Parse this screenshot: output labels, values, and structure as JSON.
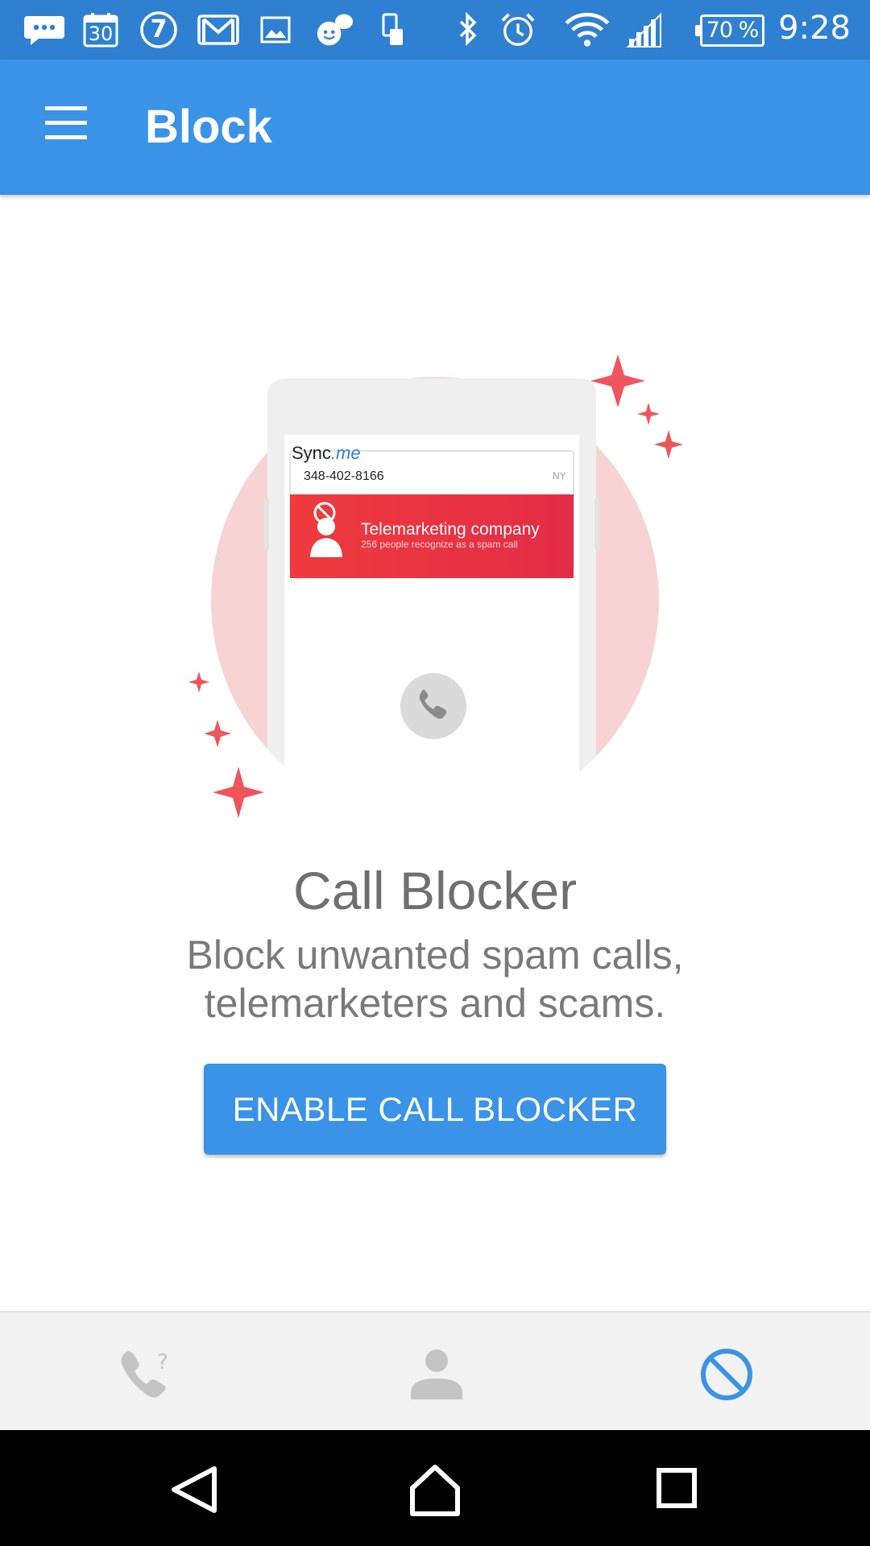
{
  "status_bar": {
    "calendar_day": "30",
    "badge_number": "7",
    "battery": "70 %",
    "time": "9:28"
  },
  "app_bar": {
    "title": "Block"
  },
  "illustration": {
    "brand": "Sync.me",
    "phone_number": "348-402-8166",
    "region": "NY",
    "caller_label": "Telemarketing company",
    "caller_sub": "256 people recognize as a spam call"
  },
  "content": {
    "title": "Call Blocker",
    "description": "Block unwanted spam calls, telemarketers and scams.",
    "button_label": "ENABLE CALL BLOCKER"
  },
  "tabs": [
    {
      "name": "unknown-calls",
      "icon": "phone-question-icon",
      "active": false
    },
    {
      "name": "contacts",
      "icon": "person-icon",
      "active": false
    },
    {
      "name": "block",
      "icon": "block-icon",
      "active": true
    }
  ],
  "colors": {
    "status_bar": "#2f80d1",
    "app_bar": "#3a93e6",
    "accent": "#3a93e6",
    "spam_red": "#e8303f",
    "circle_pink": "#f8d3d3",
    "sparkle": "#f0555e"
  }
}
